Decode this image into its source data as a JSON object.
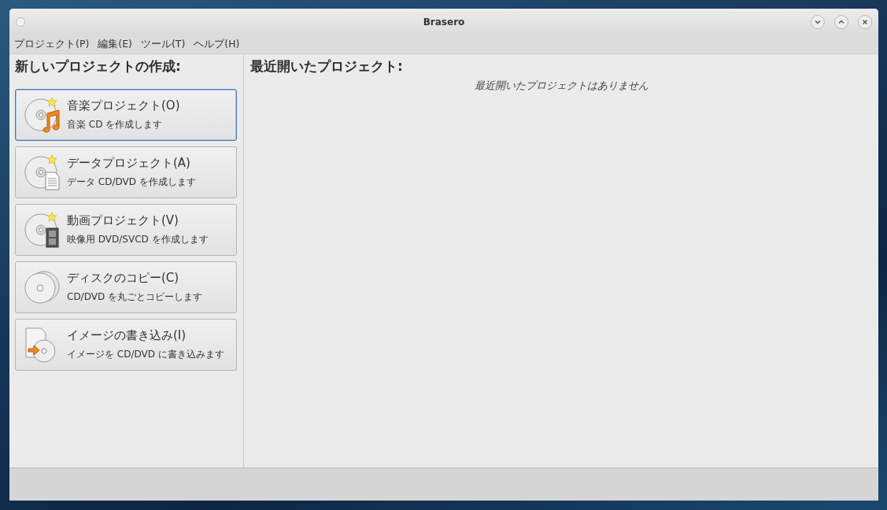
{
  "window": {
    "title": "Brasero"
  },
  "menu": [
    "プロジェクト(P)",
    "編集(E)",
    "ツール(T)",
    "ヘルプ(H)"
  ],
  "new_project": {
    "heading": "新しいプロジェクトの作成:",
    "items": [
      {
        "kind": "audio",
        "title": "音楽プロジェクト(O)",
        "subtitle": "音楽 CD を作成します",
        "focused": true
      },
      {
        "kind": "data",
        "title": "データプロジェクト(A)",
        "subtitle": "データ CD/DVD を作成します",
        "focused": false
      },
      {
        "kind": "video",
        "title": "動画プロジェクト(V)",
        "subtitle": "映像用 DVD/SVCD を作成します",
        "focused": false
      },
      {
        "kind": "copy",
        "title": "ディスクのコピー(C)",
        "subtitle": "CD/DVD を丸ごとコピーします",
        "focused": false
      },
      {
        "kind": "image",
        "title": "イメージの書き込み(I)",
        "subtitle": "イメージを CD/DVD に書き込みます",
        "focused": false
      }
    ]
  },
  "recent": {
    "heading": "最近開いたプロジェクト:",
    "empty_message": "最近開いたプロジェクトはありません"
  }
}
